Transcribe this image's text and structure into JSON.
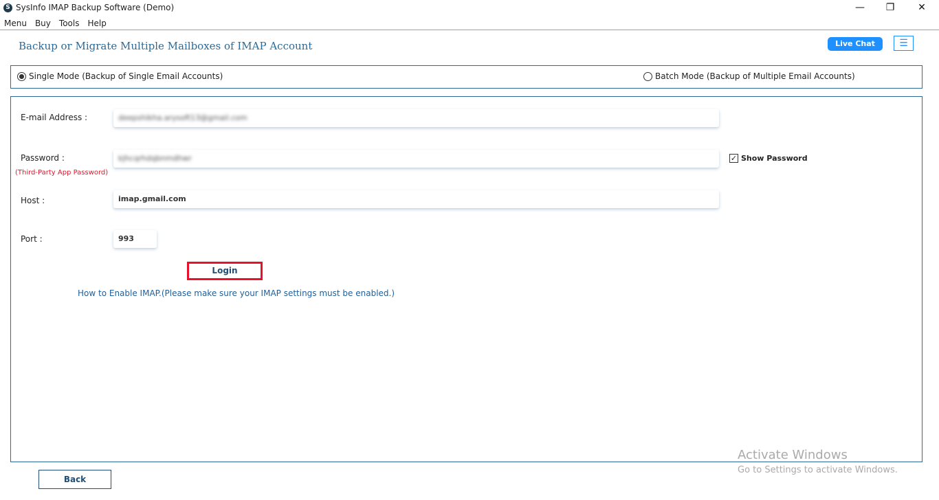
{
  "window": {
    "title": "SysInfo IMAP Backup Software (Demo)",
    "minimize": "—",
    "restore": "❐",
    "close": "✕",
    "logo": "S"
  },
  "menu": [
    "Menu",
    "Buy",
    "Tools",
    "Help"
  ],
  "header": {
    "title": "Backup or Migrate Multiple Mailboxes of IMAP Account",
    "live_chat": "Live Chat",
    "hamburger": "☰"
  },
  "modes": {
    "single": "Single Mode (Backup of Single Email Accounts)",
    "batch": "Batch Mode (Backup of Multiple Email Accounts)",
    "selected": "single"
  },
  "form": {
    "email_label": "E-mail Address :",
    "email_value": "deepshikha.arysoft13@gmail.com",
    "password_label": "Password :",
    "password_hint": "(Third-Party App Password)",
    "password_value": "kjhcqrhdqbnmdhwr",
    "show_password": "Show Password",
    "show_password_checked": true,
    "host_label": "Host :",
    "host_value": "imap.gmail.com",
    "port_label": "Port :",
    "port_value": "993",
    "login": "Login",
    "imap_link": "How to Enable IMAP.(Please make sure your IMAP settings must be enabled.)"
  },
  "footer": {
    "back": "Back"
  },
  "watermark": {
    "line1": "Activate Windows",
    "line2": "Go to Settings to activate Windows."
  }
}
